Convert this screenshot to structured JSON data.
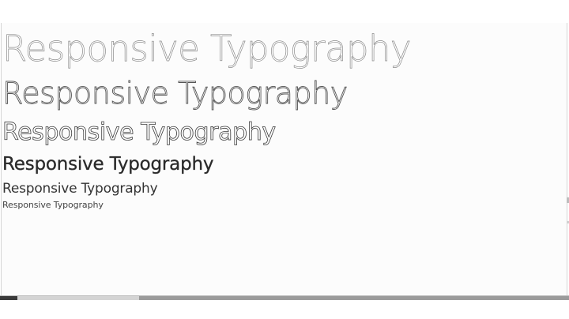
{
  "content": {
    "lines": [
      "Responsive Typography",
      "Responsive Typography",
      "Responsive Typography",
      "Responsive Typography",
      "Responsive Typography",
      "Responsive Typography"
    ]
  }
}
